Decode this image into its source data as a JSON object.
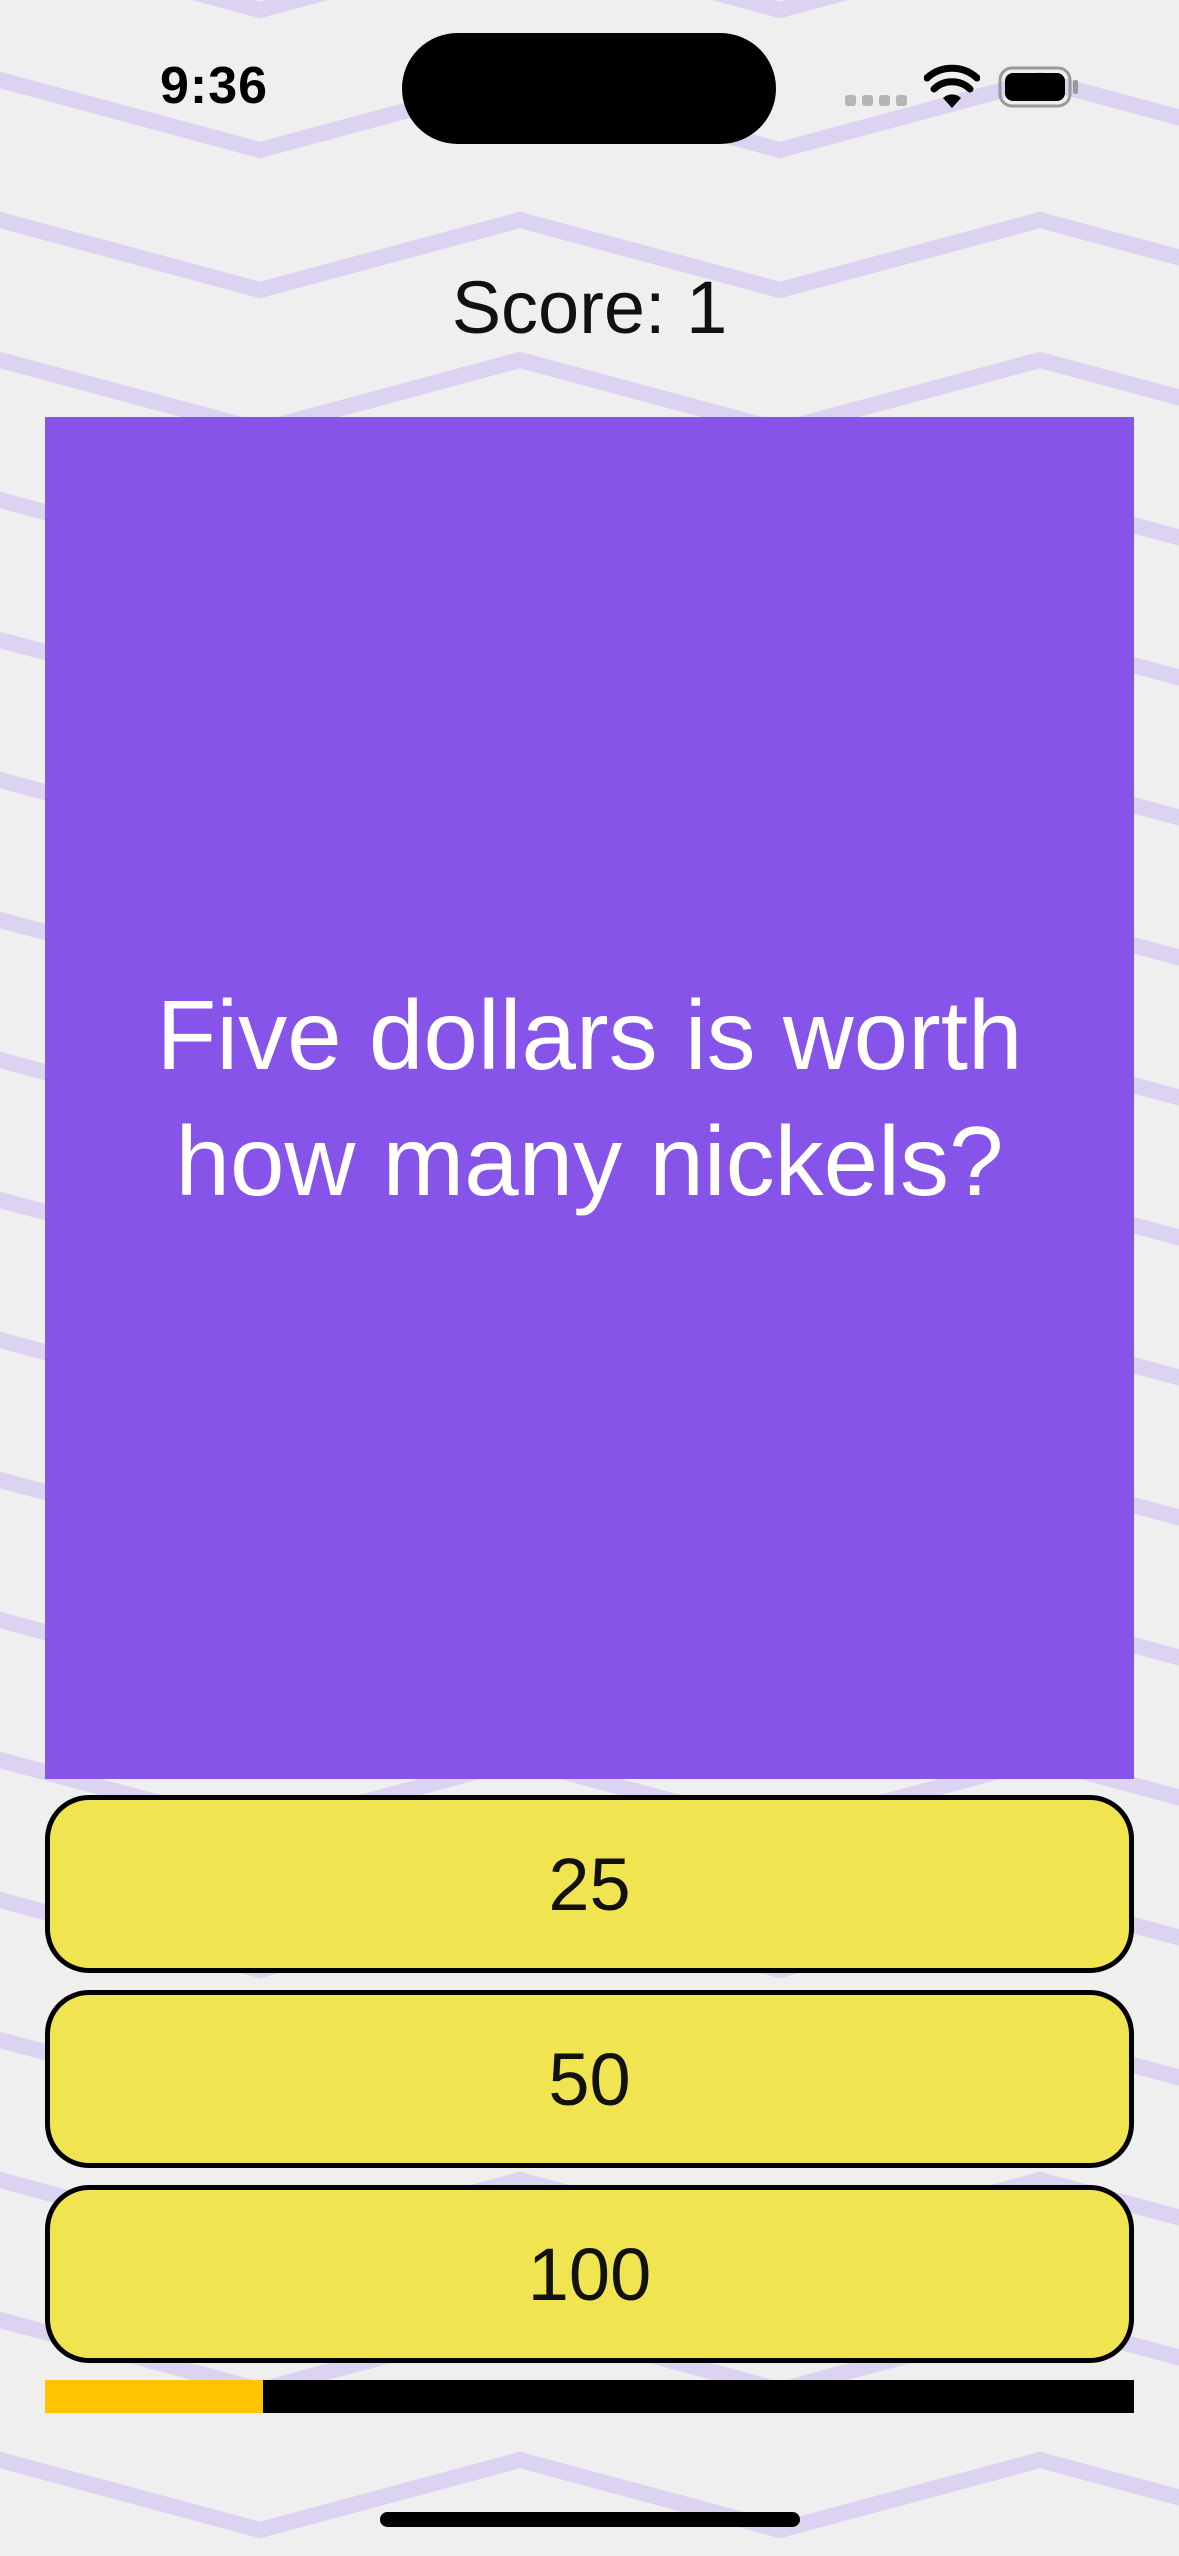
{
  "status_bar": {
    "time": "9:36"
  },
  "score": {
    "text": "Score: 1"
  },
  "question": {
    "text": "Five dollars is worth how many nickels?"
  },
  "answers": [
    {
      "label": "25"
    },
    {
      "label": "50"
    },
    {
      "label": "100"
    }
  ],
  "progress": {
    "fraction": 0.2
  },
  "colors": {
    "background": "#efefef",
    "pattern": "#dcd2f1",
    "card": "#8654e8",
    "answer_fill": "#f0e551",
    "progress_fill": "#ffc300",
    "progress_track": "#000000"
  },
  "icons": [
    "wifi-icon",
    "battery-icon",
    "signal-dots-icon"
  ]
}
